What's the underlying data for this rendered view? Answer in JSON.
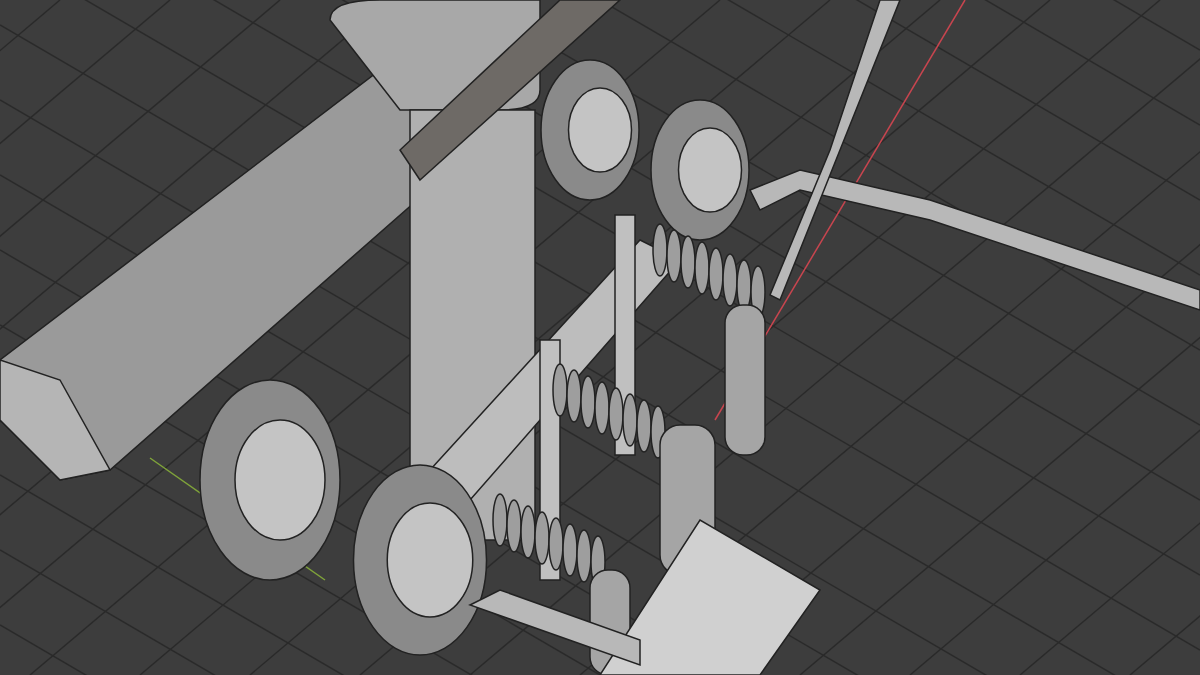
{
  "viewport": {
    "axes": [
      {
        "kind": "x",
        "color": "#c8454f"
      },
      {
        "kind": "y",
        "color": "#7fa33a"
      }
    ]
  }
}
